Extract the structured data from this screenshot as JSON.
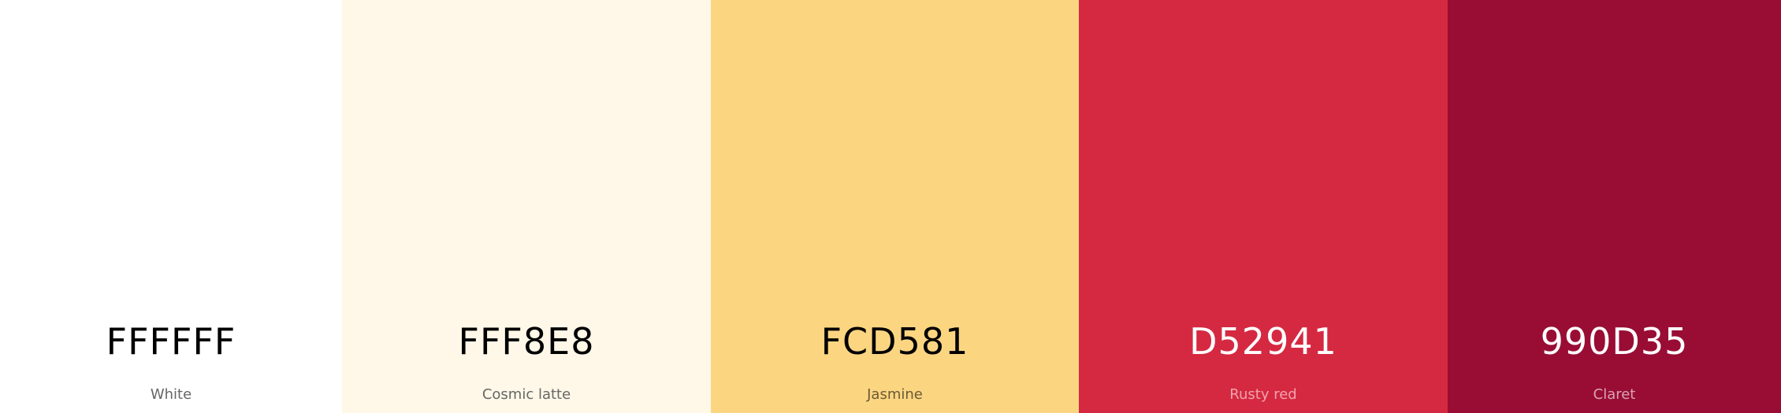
{
  "palette": {
    "swatches": [
      {
        "hex": "FFFFFF",
        "name": "White",
        "color": "#FFFFFF",
        "text_color": "#000000",
        "name_color": "#666666"
      },
      {
        "hex": "FFF8E8",
        "name": "Cosmic latte",
        "color": "#FFF8E8",
        "text_color": "#000000",
        "name_color": "#666666"
      },
      {
        "hex": "FCD581",
        "name": "Jasmine",
        "color": "#FCD581",
        "text_color": "#000000",
        "name_color": "#6b5a35"
      },
      {
        "hex": "D52941",
        "name": "Rusty red",
        "color": "#D52941",
        "text_color": "#ffffff",
        "name_color": "#f2a3ad"
      },
      {
        "hex": "990D35",
        "name": "Claret",
        "color": "#990D35",
        "text_color": "#ffffff",
        "name_color": "#d9a3b3"
      }
    ]
  }
}
